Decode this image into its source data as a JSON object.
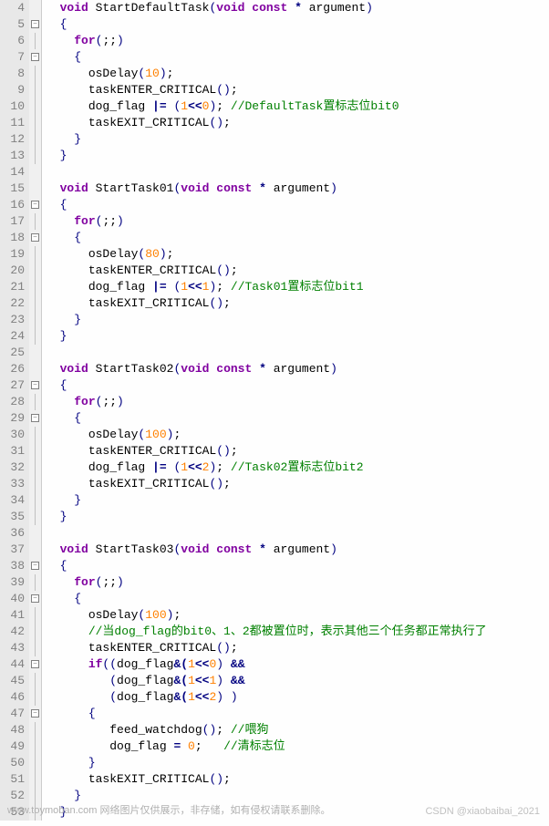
{
  "lines": [
    {
      "n": 4,
      "fold": "",
      "indent": "  ",
      "tokens": [
        {
          "t": "void ",
          "c": "kw"
        },
        {
          "t": "StartDefaultTask",
          "c": "func"
        },
        {
          "t": "(",
          "c": "paren"
        },
        {
          "t": "void const ",
          "c": "kw"
        },
        {
          "t": "* ",
          "c": "op"
        },
        {
          "t": "argument",
          "c": "ident"
        },
        {
          "t": ")",
          "c": "paren"
        }
      ]
    },
    {
      "n": 5,
      "fold": "-",
      "indent": "  ",
      "tokens": [
        {
          "t": "{",
          "c": "brace"
        }
      ]
    },
    {
      "n": 6,
      "fold": "|",
      "indent": "    ",
      "tokens": [
        {
          "t": "for",
          "c": "kw"
        },
        {
          "t": "(",
          "c": "paren"
        },
        {
          "t": ";;",
          "c": "punct"
        },
        {
          "t": ")",
          "c": "paren"
        }
      ]
    },
    {
      "n": 7,
      "fold": "-",
      "indent": "    ",
      "tokens": [
        {
          "t": "{",
          "c": "brace"
        }
      ]
    },
    {
      "n": 8,
      "fold": "|",
      "indent": "      ",
      "tokens": [
        {
          "t": "osDelay",
          "c": "func"
        },
        {
          "t": "(",
          "c": "paren"
        },
        {
          "t": "10",
          "c": "num"
        },
        {
          "t": ")",
          "c": "paren"
        },
        {
          "t": ";",
          "c": "punct"
        }
      ]
    },
    {
      "n": 9,
      "fold": "|",
      "indent": "      ",
      "tokens": [
        {
          "t": "taskENTER_CRITICAL",
          "c": "func"
        },
        {
          "t": "()",
          "c": "paren"
        },
        {
          "t": ";",
          "c": "punct"
        }
      ]
    },
    {
      "n": 10,
      "fold": "|",
      "indent": "      ",
      "tokens": [
        {
          "t": "dog_flag ",
          "c": "ident"
        },
        {
          "t": "|= ",
          "c": "op"
        },
        {
          "t": "(",
          "c": "paren"
        },
        {
          "t": "1",
          "c": "num"
        },
        {
          "t": "<<",
          "c": "op"
        },
        {
          "t": "0",
          "c": "num"
        },
        {
          "t": ")",
          "c": "paren"
        },
        {
          "t": "; ",
          "c": "punct"
        },
        {
          "t": "//DefaultTask置标志位bit0",
          "c": "comment"
        }
      ]
    },
    {
      "n": 11,
      "fold": "|",
      "indent": "      ",
      "tokens": [
        {
          "t": "taskEXIT_CRITICAL",
          "c": "func"
        },
        {
          "t": "()",
          "c": "paren"
        },
        {
          "t": ";",
          "c": "punct"
        }
      ]
    },
    {
      "n": 12,
      "fold": "|",
      "indent": "    ",
      "tokens": [
        {
          "t": "}",
          "c": "brace"
        }
      ]
    },
    {
      "n": 13,
      "fold": "|",
      "indent": "  ",
      "tokens": [
        {
          "t": "}",
          "c": "brace"
        }
      ]
    },
    {
      "n": 14,
      "fold": "",
      "indent": "",
      "tokens": []
    },
    {
      "n": 15,
      "fold": "",
      "indent": "  ",
      "tokens": [
        {
          "t": "void ",
          "c": "kw"
        },
        {
          "t": "StartTask01",
          "c": "func"
        },
        {
          "t": "(",
          "c": "paren"
        },
        {
          "t": "void const ",
          "c": "kw"
        },
        {
          "t": "* ",
          "c": "op"
        },
        {
          "t": "argument",
          "c": "ident"
        },
        {
          "t": ")",
          "c": "paren"
        }
      ]
    },
    {
      "n": 16,
      "fold": "-",
      "indent": "  ",
      "tokens": [
        {
          "t": "{",
          "c": "brace"
        }
      ]
    },
    {
      "n": 17,
      "fold": "|",
      "indent": "    ",
      "tokens": [
        {
          "t": "for",
          "c": "kw"
        },
        {
          "t": "(",
          "c": "paren"
        },
        {
          "t": ";;",
          "c": "punct"
        },
        {
          "t": ")",
          "c": "paren"
        }
      ]
    },
    {
      "n": 18,
      "fold": "-",
      "indent": "    ",
      "tokens": [
        {
          "t": "{",
          "c": "brace"
        }
      ]
    },
    {
      "n": 19,
      "fold": "|",
      "indent": "      ",
      "tokens": [
        {
          "t": "osDelay",
          "c": "func"
        },
        {
          "t": "(",
          "c": "paren"
        },
        {
          "t": "80",
          "c": "num"
        },
        {
          "t": ")",
          "c": "paren"
        },
        {
          "t": ";",
          "c": "punct"
        }
      ]
    },
    {
      "n": 20,
      "fold": "|",
      "indent": "      ",
      "tokens": [
        {
          "t": "taskENTER_CRITICAL",
          "c": "func"
        },
        {
          "t": "()",
          "c": "paren"
        },
        {
          "t": ";",
          "c": "punct"
        }
      ]
    },
    {
      "n": 21,
      "fold": "|",
      "indent": "      ",
      "tokens": [
        {
          "t": "dog_flag ",
          "c": "ident"
        },
        {
          "t": "|= ",
          "c": "op"
        },
        {
          "t": "(",
          "c": "paren"
        },
        {
          "t": "1",
          "c": "num"
        },
        {
          "t": "<<",
          "c": "op"
        },
        {
          "t": "1",
          "c": "num"
        },
        {
          "t": ")",
          "c": "paren"
        },
        {
          "t": "; ",
          "c": "punct"
        },
        {
          "t": "//Task01置标志位bit1",
          "c": "comment"
        }
      ]
    },
    {
      "n": 22,
      "fold": "|",
      "indent": "      ",
      "tokens": [
        {
          "t": "taskEXIT_CRITICAL",
          "c": "func"
        },
        {
          "t": "()",
          "c": "paren"
        },
        {
          "t": ";",
          "c": "punct"
        }
      ]
    },
    {
      "n": 23,
      "fold": "|",
      "indent": "    ",
      "tokens": [
        {
          "t": "}",
          "c": "brace"
        }
      ]
    },
    {
      "n": 24,
      "fold": "|",
      "indent": "  ",
      "tokens": [
        {
          "t": "}",
          "c": "brace"
        }
      ]
    },
    {
      "n": 25,
      "fold": "",
      "indent": "",
      "tokens": []
    },
    {
      "n": 26,
      "fold": "",
      "indent": "  ",
      "tokens": [
        {
          "t": "void ",
          "c": "kw"
        },
        {
          "t": "StartTask02",
          "c": "func"
        },
        {
          "t": "(",
          "c": "paren"
        },
        {
          "t": "void const ",
          "c": "kw"
        },
        {
          "t": "* ",
          "c": "op"
        },
        {
          "t": "argument",
          "c": "ident"
        },
        {
          "t": ")",
          "c": "paren"
        }
      ]
    },
    {
      "n": 27,
      "fold": "-",
      "indent": "  ",
      "tokens": [
        {
          "t": "{",
          "c": "brace"
        }
      ]
    },
    {
      "n": 28,
      "fold": "|",
      "indent": "    ",
      "tokens": [
        {
          "t": "for",
          "c": "kw"
        },
        {
          "t": "(",
          "c": "paren"
        },
        {
          "t": ";;",
          "c": "punct"
        },
        {
          "t": ")",
          "c": "paren"
        }
      ]
    },
    {
      "n": 29,
      "fold": "-",
      "indent": "    ",
      "tokens": [
        {
          "t": "{",
          "c": "brace"
        }
      ]
    },
    {
      "n": 30,
      "fold": "|",
      "indent": "      ",
      "tokens": [
        {
          "t": "osDelay",
          "c": "func"
        },
        {
          "t": "(",
          "c": "paren"
        },
        {
          "t": "100",
          "c": "num"
        },
        {
          "t": ")",
          "c": "paren"
        },
        {
          "t": ";",
          "c": "punct"
        }
      ]
    },
    {
      "n": 31,
      "fold": "|",
      "indent": "      ",
      "tokens": [
        {
          "t": "taskENTER_CRITICAL",
          "c": "func"
        },
        {
          "t": "()",
          "c": "paren"
        },
        {
          "t": ";",
          "c": "punct"
        }
      ]
    },
    {
      "n": 32,
      "fold": "|",
      "indent": "      ",
      "tokens": [
        {
          "t": "dog_flag ",
          "c": "ident"
        },
        {
          "t": "|= ",
          "c": "op"
        },
        {
          "t": "(",
          "c": "paren"
        },
        {
          "t": "1",
          "c": "num"
        },
        {
          "t": "<<",
          "c": "op"
        },
        {
          "t": "2",
          "c": "num"
        },
        {
          "t": ")",
          "c": "paren"
        },
        {
          "t": "; ",
          "c": "punct"
        },
        {
          "t": "//Task02置标志位bit2",
          "c": "comment"
        }
      ]
    },
    {
      "n": 33,
      "fold": "|",
      "indent": "      ",
      "tokens": [
        {
          "t": "taskEXIT_CRITICAL",
          "c": "func"
        },
        {
          "t": "()",
          "c": "paren"
        },
        {
          "t": ";",
          "c": "punct"
        }
      ]
    },
    {
      "n": 34,
      "fold": "|",
      "indent": "    ",
      "tokens": [
        {
          "t": "}",
          "c": "brace"
        }
      ]
    },
    {
      "n": 35,
      "fold": "|",
      "indent": "  ",
      "tokens": [
        {
          "t": "}",
          "c": "brace"
        }
      ]
    },
    {
      "n": 36,
      "fold": "",
      "indent": "",
      "tokens": []
    },
    {
      "n": 37,
      "fold": "",
      "indent": "  ",
      "tokens": [
        {
          "t": "void ",
          "c": "kw"
        },
        {
          "t": "StartTask03",
          "c": "func"
        },
        {
          "t": "(",
          "c": "paren"
        },
        {
          "t": "void const ",
          "c": "kw"
        },
        {
          "t": "* ",
          "c": "op"
        },
        {
          "t": "argument",
          "c": "ident"
        },
        {
          "t": ")",
          "c": "paren"
        }
      ]
    },
    {
      "n": 38,
      "fold": "-",
      "indent": "  ",
      "tokens": [
        {
          "t": "{",
          "c": "brace"
        }
      ]
    },
    {
      "n": 39,
      "fold": "|",
      "indent": "    ",
      "tokens": [
        {
          "t": "for",
          "c": "kw"
        },
        {
          "t": "(",
          "c": "paren"
        },
        {
          "t": ";;",
          "c": "punct"
        },
        {
          "t": ")",
          "c": "paren"
        }
      ]
    },
    {
      "n": 40,
      "fold": "-",
      "indent": "    ",
      "tokens": [
        {
          "t": "{",
          "c": "brace"
        }
      ]
    },
    {
      "n": 41,
      "fold": "|",
      "indent": "      ",
      "tokens": [
        {
          "t": "osDelay",
          "c": "func"
        },
        {
          "t": "(",
          "c": "paren"
        },
        {
          "t": "100",
          "c": "num"
        },
        {
          "t": ")",
          "c": "paren"
        },
        {
          "t": ";",
          "c": "punct"
        }
      ]
    },
    {
      "n": 42,
      "fold": "|",
      "indent": "      ",
      "tokens": [
        {
          "t": "//当dog_flag的bit0、1、2都被置位时，表示其他三个任务都正常执行了",
          "c": "comment"
        }
      ]
    },
    {
      "n": 43,
      "fold": "|",
      "indent": "      ",
      "tokens": [
        {
          "t": "taskENTER_CRITICAL",
          "c": "func"
        },
        {
          "t": "()",
          "c": "paren"
        },
        {
          "t": ";",
          "c": "punct"
        }
      ]
    },
    {
      "n": 44,
      "fold": "-",
      "indent": "      ",
      "tokens": [
        {
          "t": "if",
          "c": "kw"
        },
        {
          "t": "((",
          "c": "paren"
        },
        {
          "t": "dog_flag",
          "c": "ident"
        },
        {
          "t": "&(",
          "c": "op"
        },
        {
          "t": "1",
          "c": "num"
        },
        {
          "t": "<<",
          "c": "op"
        },
        {
          "t": "0",
          "c": "num"
        },
        {
          "t": ") ",
          "c": "paren"
        },
        {
          "t": "&&",
          "c": "op"
        }
      ]
    },
    {
      "n": 45,
      "fold": "|",
      "indent": "         ",
      "tokens": [
        {
          "t": "(",
          "c": "paren"
        },
        {
          "t": "dog_flag",
          "c": "ident"
        },
        {
          "t": "&(",
          "c": "op"
        },
        {
          "t": "1",
          "c": "num"
        },
        {
          "t": "<<",
          "c": "op"
        },
        {
          "t": "1",
          "c": "num"
        },
        {
          "t": ") ",
          "c": "paren"
        },
        {
          "t": "&&",
          "c": "op"
        }
      ]
    },
    {
      "n": 46,
      "fold": "|",
      "indent": "         ",
      "tokens": [
        {
          "t": "(",
          "c": "paren"
        },
        {
          "t": "dog_flag",
          "c": "ident"
        },
        {
          "t": "&(",
          "c": "op"
        },
        {
          "t": "1",
          "c": "num"
        },
        {
          "t": "<<",
          "c": "op"
        },
        {
          "t": "2",
          "c": "num"
        },
        {
          "t": ") )",
          "c": "paren"
        }
      ]
    },
    {
      "n": 47,
      "fold": "-",
      "indent": "      ",
      "tokens": [
        {
          "t": "{",
          "c": "brace"
        }
      ]
    },
    {
      "n": 48,
      "fold": "|",
      "indent": "         ",
      "tokens": [
        {
          "t": "feed_watchdog",
          "c": "func"
        },
        {
          "t": "()",
          "c": "paren"
        },
        {
          "t": "; ",
          "c": "punct"
        },
        {
          "t": "//喂狗",
          "c": "comment"
        }
      ]
    },
    {
      "n": 49,
      "fold": "|",
      "indent": "         ",
      "tokens": [
        {
          "t": "dog_flag ",
          "c": "ident"
        },
        {
          "t": "= ",
          "c": "op"
        },
        {
          "t": "0",
          "c": "num"
        },
        {
          "t": ";   ",
          "c": "punct"
        },
        {
          "t": "//清标志位",
          "c": "comment"
        }
      ]
    },
    {
      "n": 50,
      "fold": "|",
      "indent": "      ",
      "tokens": [
        {
          "t": "}",
          "c": "brace"
        }
      ]
    },
    {
      "n": 51,
      "fold": "|",
      "indent": "      ",
      "tokens": [
        {
          "t": "taskEXIT_CRITICAL",
          "c": "func"
        },
        {
          "t": "()",
          "c": "paren"
        },
        {
          "t": ";",
          "c": "punct"
        }
      ]
    },
    {
      "n": 52,
      "fold": "|",
      "indent": "    ",
      "tokens": [
        {
          "t": "}",
          "c": "brace"
        }
      ]
    },
    {
      "n": 53,
      "fold": "|",
      "indent": "  ",
      "tokens": [
        {
          "t": "}",
          "c": "brace"
        }
      ]
    }
  ],
  "watermark1": "www.toymoban.com 网络图片仅供展示，非存储，如有侵权请联系删除。",
  "watermark2": "CSDN @xiaobaibai_2021"
}
